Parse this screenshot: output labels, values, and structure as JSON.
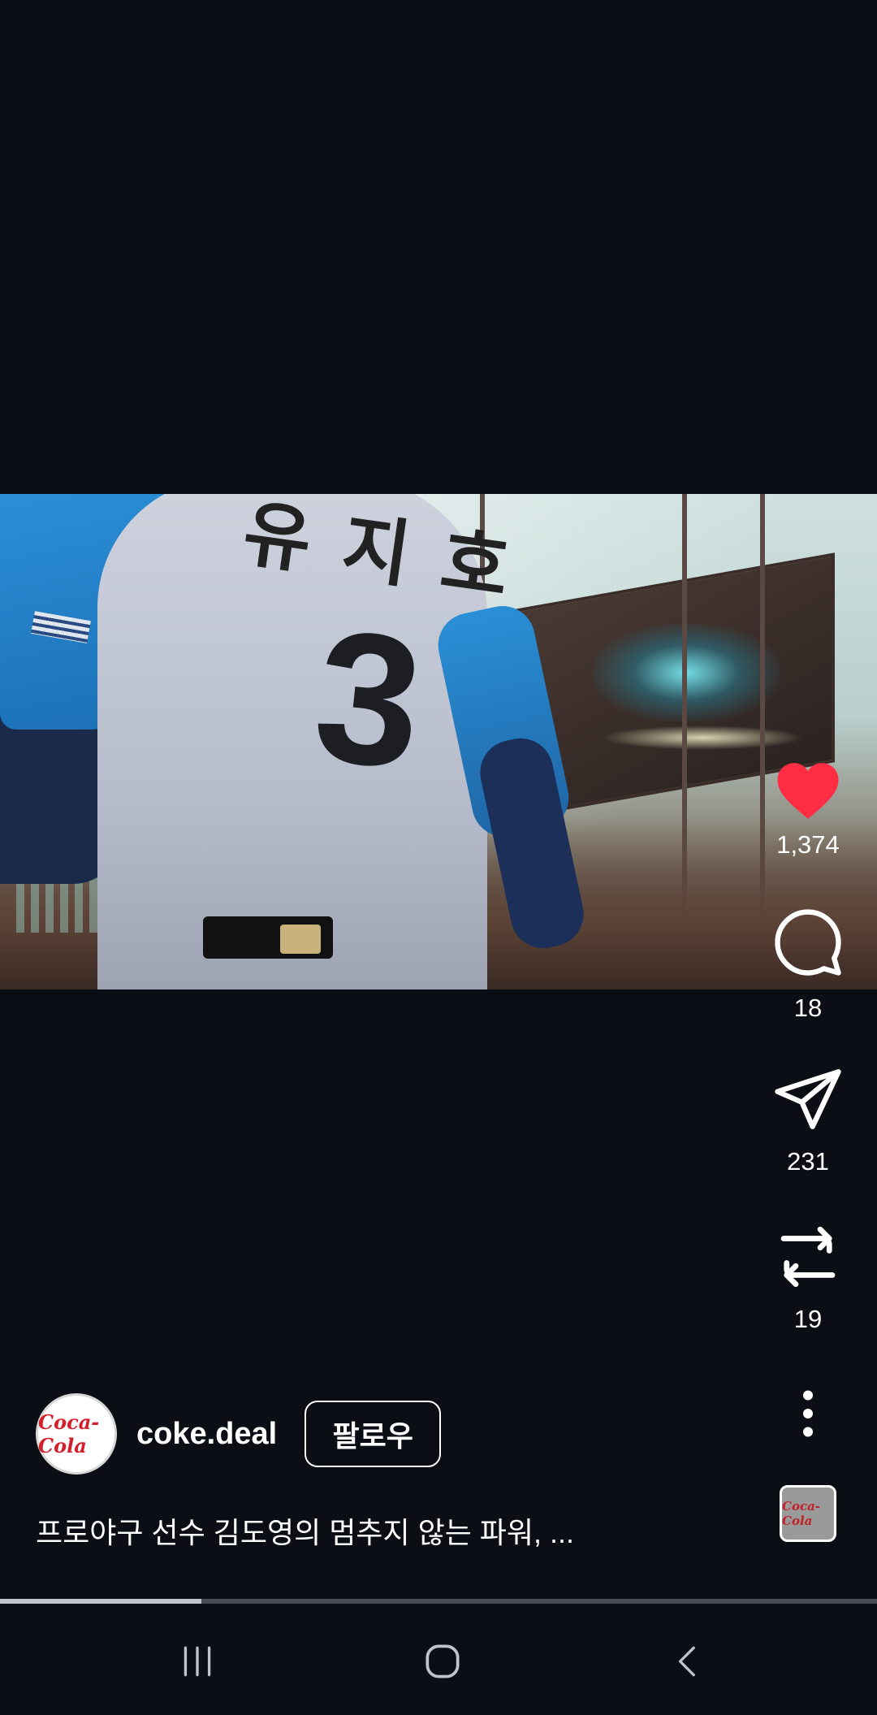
{
  "post": {
    "username": "coke.deal",
    "follow_label": "팔로우",
    "caption": "프로야구 선수 김도영의 멈추지 않는 파워, ...",
    "avatar_text": "Coca-Cola",
    "music_tile_text": "Coca-Cola"
  },
  "video": {
    "jersey_name": "유지호",
    "jersey_number": "3",
    "progress": 0.23
  },
  "actions": {
    "like": {
      "icon": "heart-icon",
      "count": "1,374",
      "liked": true,
      "color": "#ff2d44"
    },
    "comment": {
      "icon": "comment-icon",
      "count": "18"
    },
    "share": {
      "icon": "send-icon",
      "count": "231"
    },
    "repost": {
      "icon": "repost-icon",
      "count": "19"
    },
    "more": {
      "icon": "more-vertical-icon"
    }
  },
  "nav": {
    "recents": "recent-apps-icon",
    "home": "home-icon",
    "back": "back-icon"
  }
}
